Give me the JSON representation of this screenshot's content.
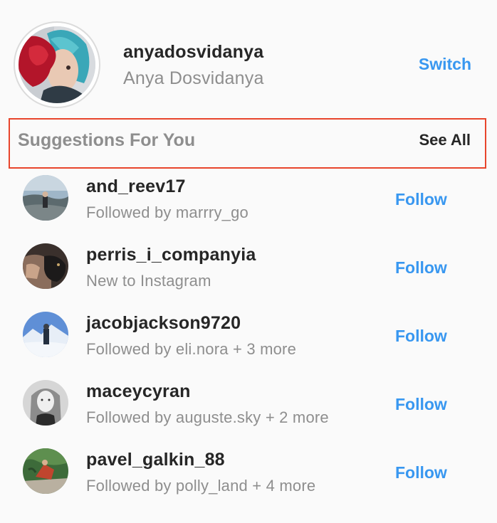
{
  "account": {
    "username": "anyadosvidanya",
    "full_name": "Anya Dosvidanya",
    "switch_label": "Switch",
    "avatar_icon": "user-avatar-photo"
  },
  "suggestions": {
    "title": "Suggestions For You",
    "see_all_label": "See All",
    "items": [
      {
        "username": "and_reev17",
        "subtitle": "Followed by marrry_go",
        "action": "Follow"
      },
      {
        "username": "perris_i_companyia",
        "subtitle": "New to Instagram",
        "action": "Follow"
      },
      {
        "username": "jacobjackson9720",
        "subtitle": "Followed by eli.nora + 3 more",
        "action": "Follow"
      },
      {
        "username": "maceycyran",
        "subtitle": "Followed by auguste.sky + 2 more",
        "action": "Follow"
      },
      {
        "username": "pavel_galkin_88",
        "subtitle": "Followed by polly_land + 4 more",
        "action": "Follow"
      }
    ]
  },
  "colors": {
    "link_blue": "#3897f0",
    "highlight_border": "#e8452c",
    "primary_text": "#262626",
    "secondary_text": "#8e8e8e"
  }
}
